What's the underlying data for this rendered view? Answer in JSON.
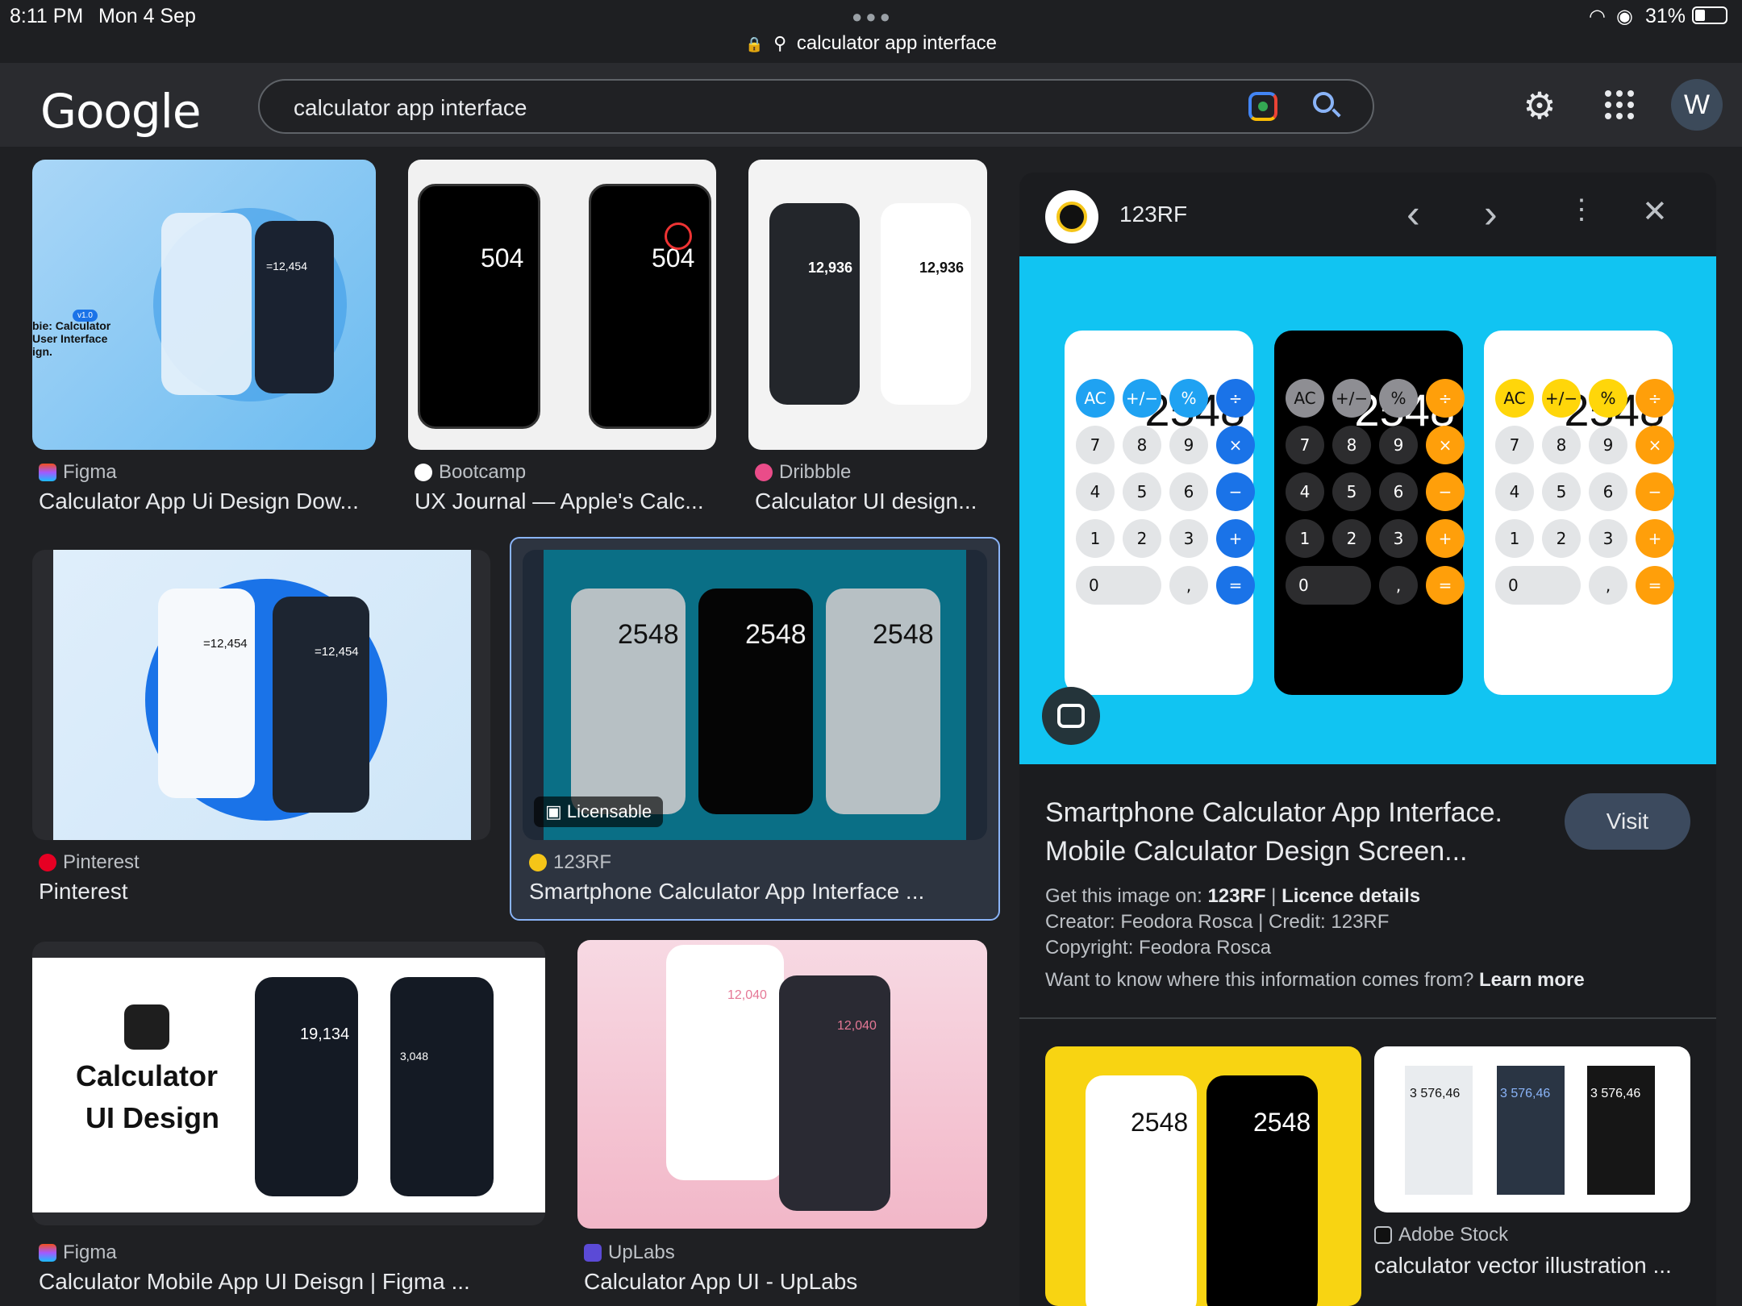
{
  "status": {
    "time": "8:11 PM",
    "date": "Mon 4 Sep",
    "battery": "31%",
    "url": "calculator app interface"
  },
  "header": {
    "logo": "Google",
    "query": "calculator app interface",
    "avatar_letter": "W"
  },
  "results": [
    {
      "source": "Figma",
      "title": "Calculator App Ui Design Dow..."
    },
    {
      "source": "Bootcamp",
      "title": "UX Journal — Apple's Calc..."
    },
    {
      "source": "Dribbble",
      "title": "Calculator UI design..."
    },
    {
      "source": "Pinterest",
      "title": "Pinterest"
    },
    {
      "source": "123RF",
      "title": "Smartphone Calculator App Interface ...",
      "badge": "Licensable"
    },
    {
      "source": "Figma",
      "title": "Calculator Mobile App UI Deisgn | Figma ..."
    },
    {
      "source": "UpLabs",
      "title": "Calculator App UI - UpLabs"
    }
  ],
  "thumbs": {
    "figma_vlabel": "v1.0",
    "figma_text": "bie: Calculator User Interface ign.",
    "figma_val": "=12,454",
    "bootcamp_val": "504",
    "dribbble_val": "12,936",
    "pinterest_val": "=12,454",
    "rf_val": "2548",
    "figma2_title_1": "Calculator",
    "figma2_title_2": "UI Design",
    "figma2_val1": "19,134",
    "figma2_val2": "3,048",
    "uplabs_val": "12,040"
  },
  "panel": {
    "source": "123RF",
    "title_line1": "Smartphone Calculator App Interface.",
    "title_line2": "Mobile Calculator Design Screen...",
    "visit": "Visit",
    "get_image_label": "Get this image on:",
    "get_image_source": "123RF",
    "separator": "|",
    "licence": "Licence details",
    "creator": "Creator: Feodora Rosca | Credit: 123RF",
    "copyright": "Copyright: Feodora Rosca",
    "want_to_know": "Want to know where this information comes from?",
    "learn_more": "Learn more",
    "display_value": "2548",
    "keys_row1": [
      "AC",
      "+/−",
      "%",
      "÷"
    ],
    "keys_row2": [
      "7",
      "8",
      "9",
      "×"
    ],
    "keys_row3": [
      "4",
      "5",
      "6",
      "−"
    ],
    "keys_row4": [
      "1",
      "2",
      "3",
      "+"
    ],
    "keys_row5": [
      "0",
      ",",
      "="
    ],
    "related": [
      {
        "source": "",
        "title": "",
        "val": "2548"
      },
      {
        "source": "Adobe Stock",
        "title": "calculator vector illustration ...",
        "val": "3 576,46"
      }
    ]
  }
}
